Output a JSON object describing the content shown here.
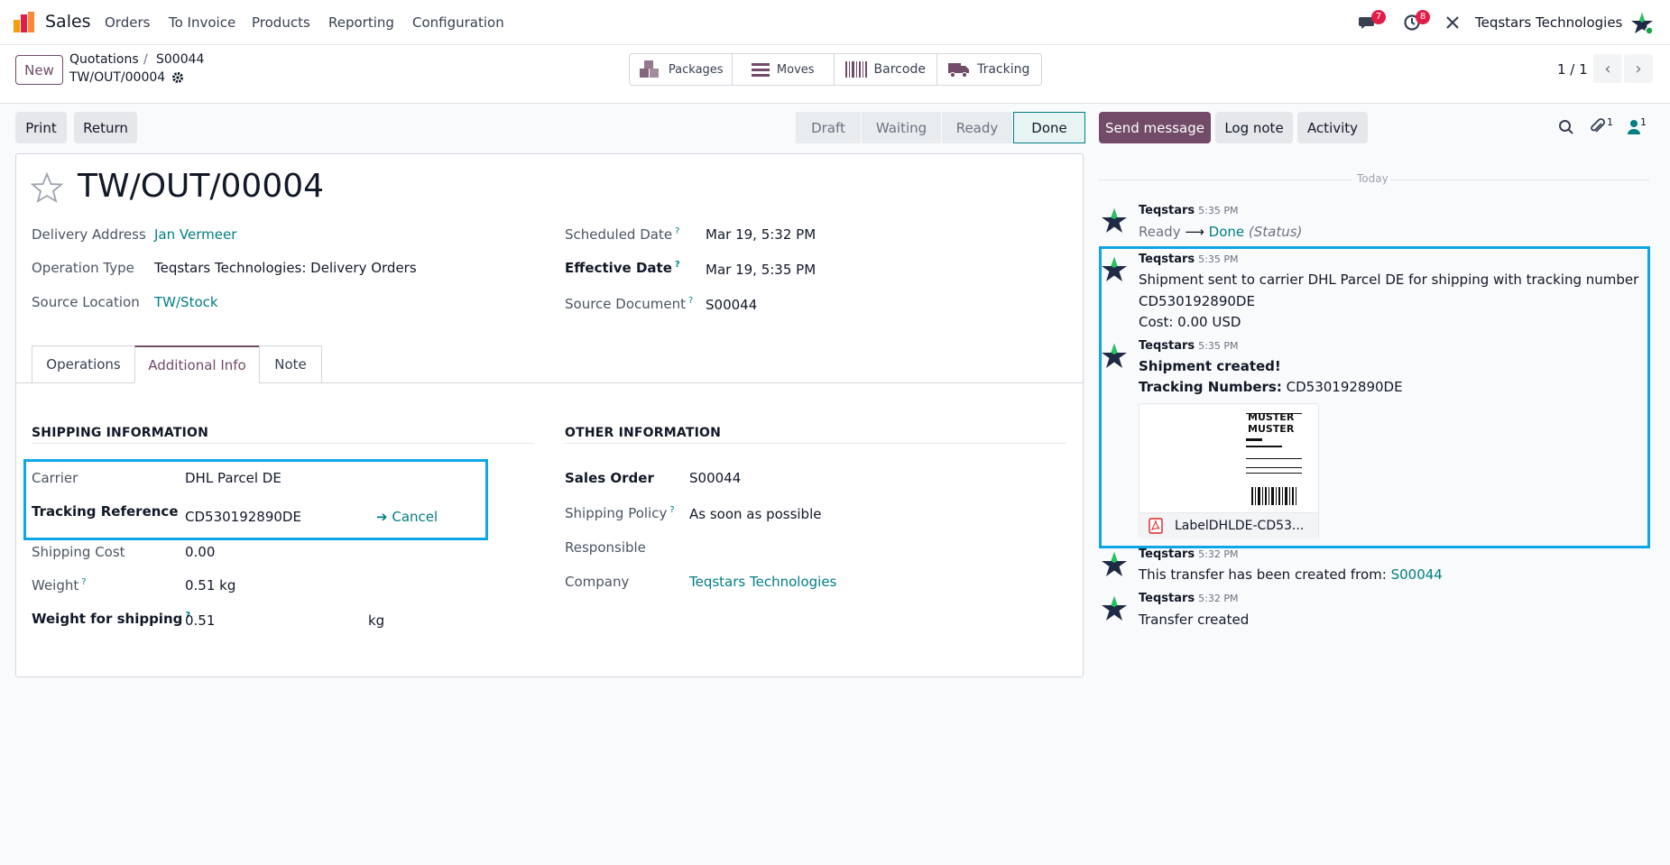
{
  "nav": {
    "app_name": "Sales",
    "menu": [
      "Orders",
      "To Invoice",
      "Products",
      "Reporting",
      "Configuration"
    ],
    "messages_badge": "7",
    "activity_badge": "8",
    "company": "Teqstars Technologies"
  },
  "control": {
    "new_label": "New",
    "breadcrumb_parent": "Quotations",
    "breadcrumb_sep": "/",
    "breadcrumb_order": "S00044",
    "record_name": "TW/OUT/00004",
    "smart_buttons": [
      "Packages",
      "Moves",
      "Barcode",
      "Tracking"
    ],
    "pager": "1 / 1"
  },
  "actions": {
    "print": "Print",
    "return": "Return",
    "statuses": [
      "Draft",
      "Waiting",
      "Ready",
      "Done"
    ],
    "active_status": "Done"
  },
  "form": {
    "title": "TW/OUT/00004",
    "left_fields": [
      {
        "label": "Delivery Address",
        "value": "Jan Vermeer"
      },
      {
        "label": "Operation Type",
        "value": "Teqstars Technologies: Delivery Orders"
      },
      {
        "label": "Source Location",
        "value": "TW/Stock"
      }
    ],
    "right_fields": [
      {
        "label": "Scheduled Date",
        "value": "Mar 19, 5:32 PM"
      },
      {
        "label": "Effective Date",
        "value": "Mar 19, 5:35 PM"
      },
      {
        "label": "Source Document",
        "value": "S00044"
      }
    ],
    "help_mark": "?",
    "tabs": [
      "Operations",
      "Additional Info",
      "Note"
    ],
    "shipping": {
      "title": "SHIPPING INFORMATION",
      "carrier_label": "Carrier",
      "carrier": "DHL Parcel DE",
      "tracking_label": "Tracking Reference",
      "tracking": "CD530192890DE",
      "cancel": "Cancel",
      "cost_label": "Shipping Cost",
      "cost": "0.00",
      "weight_label": "Weight",
      "weight": "0.51 kg",
      "wfs_label": "Weight for shipping",
      "wfs": "0.51",
      "wfs_unit": "kg"
    },
    "other": {
      "title": "OTHER INFORMATION",
      "so_label": "Sales Order",
      "so": "S00044",
      "policy_label": "Shipping Policy",
      "policy": "As soon as possible",
      "responsible_label": "Responsible",
      "company_label": "Company",
      "company": "Teqstars Technologies"
    }
  },
  "chatter": {
    "send_message": "Send message",
    "log_note": "Log note",
    "activity": "Activity",
    "attach_count": "1",
    "follower_count": "1",
    "today": "Today",
    "messages": [
      {
        "author": "Teqstars",
        "time": "5:35 PM",
        "from": "Ready",
        "arrow": "⟶",
        "to": "Done",
        "field": "(Status)"
      },
      {
        "author": "Teqstars",
        "time": "5:35 PM",
        "line1": "Shipment sent to carrier DHL Parcel DE for shipping with tracking number",
        "line2": "CD530192890DE",
        "line3": "Cost: 0.00 USD"
      },
      {
        "author": "Teqstars",
        "time": "5:35 PM",
        "bold1": "Shipment created!",
        "tn_label": "Tracking Numbers:",
        "tn_value": "CD530192890DE",
        "attachment": "LabelDHLDE-CD53...",
        "label_text1": "MUSTER",
        "label_text2": "MUSTER"
      },
      {
        "author": "Teqstars",
        "time": "5:32 PM",
        "text": "This transfer has been created from:",
        "link": "S00044"
      },
      {
        "author": "Teqstars",
        "time": "5:32 PM",
        "text": "Transfer created"
      }
    ]
  },
  "colors": {
    "brand": "#714b67",
    "link": "#017e84",
    "highlight": "#0ea5e9",
    "badge": "#e11d48"
  }
}
